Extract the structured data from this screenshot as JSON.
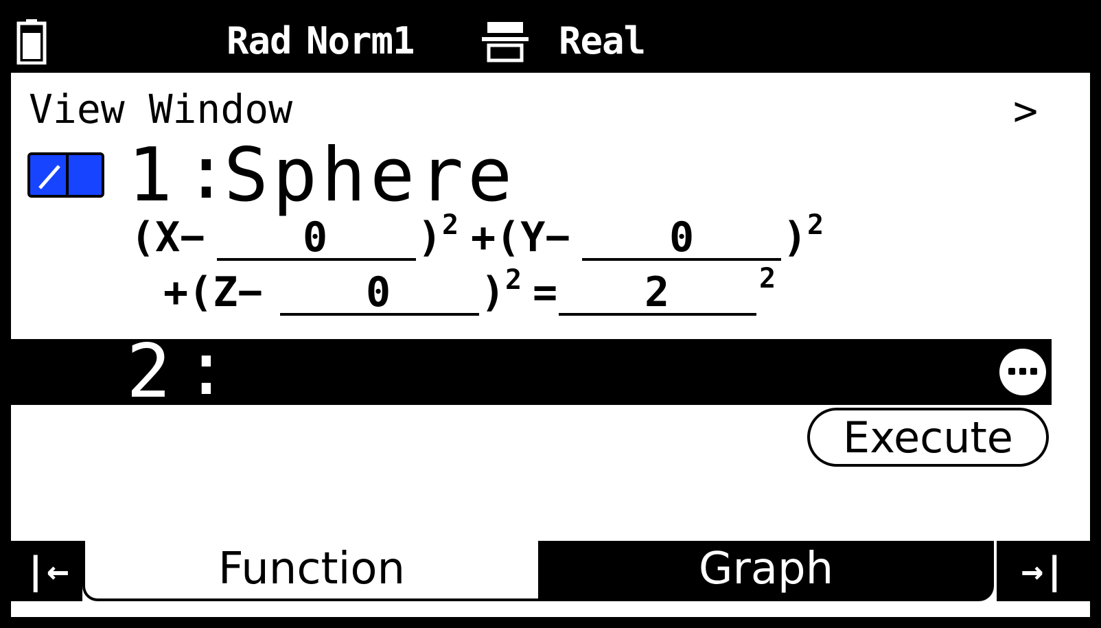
{
  "status": {
    "angle": "Rad",
    "display": "Norm1",
    "complex": "Real",
    "battery_icon": "battery-icon",
    "mode_icon": "display-mode-icon"
  },
  "header": {
    "title": "View Window",
    "next_icon": ">"
  },
  "entries": [
    {
      "number": "1",
      "separator": ":",
      "type": "Sphere",
      "checked": true,
      "equation": {
        "x_prefix": "(X−",
        "x_value": "0",
        "x_suffix": ")",
        "plus_y_prefix": "+(Y−",
        "y_value": "0",
        "y_suffix": ")",
        "plus_z_prefix": "+(Z−",
        "z_value": "0",
        "z_suffix": ")",
        "equals": "=",
        "r_value": "2",
        "exponent": "2"
      }
    },
    {
      "number": "2",
      "separator": ":",
      "type": "",
      "more_icon": "more-icon"
    }
  ],
  "actions": {
    "execute_label": "Execute"
  },
  "tabs": {
    "left_nav": "|←",
    "function_label": "Function",
    "graph_label": "Graph",
    "right_nav": "→|"
  },
  "colors": {
    "checkbox_blue": "#1744ff"
  }
}
